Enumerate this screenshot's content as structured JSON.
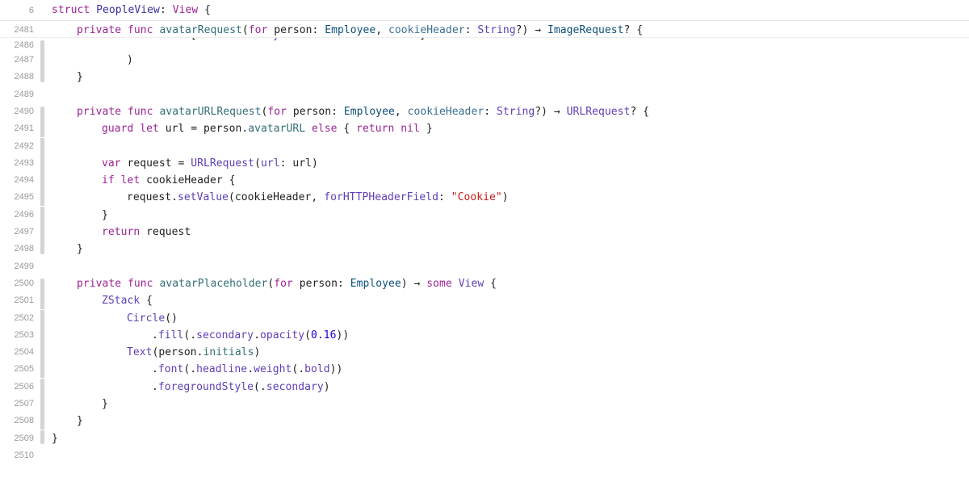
{
  "editor": {
    "sticky_header": {
      "line_number": "6",
      "tokens": [
        {
          "t": "struct",
          "c": "kw"
        },
        {
          "t": " "
        },
        {
          "t": "PeopleView",
          "c": "ty"
        },
        {
          "t": ": "
        },
        {
          "t": "View",
          "c": "kw"
        },
        {
          "t": " {"
        }
      ]
    },
    "partial_line": {
      "indent": 3,
      "tokens": [
        {
          "t": "userInfo: ["
        },
        {
          "t": ".thumbnailKey",
          "c": "mb"
        },
        {
          "t": ": "
        },
        {
          "t": "Self",
          "c": "kw"
        },
        {
          "t": "."
        },
        {
          "t": "avatarThumbnail",
          "c": "mb"
        },
        {
          "t": "]"
        }
      ]
    },
    "lines": [
      {
        "n": "2481",
        "indent": 1,
        "tokens": [
          {
            "t": "private",
            "c": "kw"
          },
          {
            "t": " "
          },
          {
            "t": "func",
            "c": "kw"
          },
          {
            "t": " "
          },
          {
            "t": "avatarRequest",
            "c": "fn"
          },
          {
            "t": "("
          },
          {
            "t": "for",
            "c": "kw"
          },
          {
            "t": " person: "
          },
          {
            "t": "Employee",
            "c": "typ"
          },
          {
            "t": ", "
          },
          {
            "t": "cookieHeader",
            "c": "lb"
          },
          {
            "t": ": "
          },
          {
            "t": "String",
            "c": "mb"
          },
          {
            "t": "?) → "
          },
          {
            "t": "ImageRequest",
            "c": "typ"
          },
          {
            "t": "? {"
          }
        ]
      },
      {
        "n": "2486",
        "indent": 0,
        "tokens": []
      },
      {
        "n": "2487",
        "indent": 3,
        "tokens": [
          {
            "t": ")"
          }
        ]
      },
      {
        "n": "2488",
        "indent": 1,
        "tokens": [
          {
            "t": "}"
          }
        ]
      },
      {
        "n": "2489",
        "indent": 0,
        "tokens": []
      },
      {
        "n": "2490",
        "indent": 1,
        "tokens": [
          {
            "t": "private",
            "c": "kw"
          },
          {
            "t": " "
          },
          {
            "t": "func",
            "c": "kw"
          },
          {
            "t": " "
          },
          {
            "t": "avatarURLRequest",
            "c": "fn"
          },
          {
            "t": "("
          },
          {
            "t": "for",
            "c": "kw"
          },
          {
            "t": " person: "
          },
          {
            "t": "Employee",
            "c": "typ"
          },
          {
            "t": ", "
          },
          {
            "t": "cookieHeader",
            "c": "lb"
          },
          {
            "t": ": "
          },
          {
            "t": "String",
            "c": "mb"
          },
          {
            "t": "?) → "
          },
          {
            "t": "URLRequest",
            "c": "mb"
          },
          {
            "t": "? {"
          }
        ]
      },
      {
        "n": "2491",
        "indent": 2,
        "tokens": [
          {
            "t": "guard",
            "c": "kw"
          },
          {
            "t": " "
          },
          {
            "t": "let",
            "c": "kw"
          },
          {
            "t": " url = person."
          },
          {
            "t": "avatarURL",
            "c": "fn"
          },
          {
            "t": " "
          },
          {
            "t": "else",
            "c": "kw"
          },
          {
            "t": " { "
          },
          {
            "t": "return",
            "c": "kw"
          },
          {
            "t": " "
          },
          {
            "t": "nil",
            "c": "kw"
          },
          {
            "t": " }"
          }
        ]
      },
      {
        "n": "2492",
        "indent": 0,
        "tokens": []
      },
      {
        "n": "2493",
        "indent": 2,
        "tokens": [
          {
            "t": "var",
            "c": "kw"
          },
          {
            "t": " request = "
          },
          {
            "t": "URLRequest",
            "c": "mb"
          },
          {
            "t": "("
          },
          {
            "t": "url",
            "c": "mb"
          },
          {
            "t": ": url)"
          }
        ]
      },
      {
        "n": "2494",
        "indent": 2,
        "tokens": [
          {
            "t": "if",
            "c": "kw"
          },
          {
            "t": " "
          },
          {
            "t": "let",
            "c": "kw"
          },
          {
            "t": " cookieHeader {"
          }
        ]
      },
      {
        "n": "2495",
        "indent": 3,
        "tokens": [
          {
            "t": "request."
          },
          {
            "t": "setValue",
            "c": "mb"
          },
          {
            "t": "(cookieHeader, "
          },
          {
            "t": "forHTTPHeaderField",
            "c": "mb"
          },
          {
            "t": ": "
          },
          {
            "t": "\"Cookie\"",
            "c": "str"
          },
          {
            "t": ")"
          }
        ]
      },
      {
        "n": "2496",
        "indent": 2,
        "tokens": [
          {
            "t": "}"
          }
        ]
      },
      {
        "n": "2497",
        "indent": 2,
        "tokens": [
          {
            "t": "return",
            "c": "kw"
          },
          {
            "t": " request"
          }
        ]
      },
      {
        "n": "2498",
        "indent": 1,
        "tokens": [
          {
            "t": "}"
          }
        ]
      },
      {
        "n": "2499",
        "indent": 0,
        "tokens": []
      },
      {
        "n": "2500",
        "indent": 1,
        "tokens": [
          {
            "t": "private",
            "c": "kw"
          },
          {
            "t": " "
          },
          {
            "t": "func",
            "c": "kw"
          },
          {
            "t": " "
          },
          {
            "t": "avatarPlaceholder",
            "c": "fn"
          },
          {
            "t": "("
          },
          {
            "t": "for",
            "c": "kw"
          },
          {
            "t": " person: "
          },
          {
            "t": "Employee",
            "c": "typ"
          },
          {
            "t": ") → "
          },
          {
            "t": "some",
            "c": "kw"
          },
          {
            "t": " "
          },
          {
            "t": "View",
            "c": "mb"
          },
          {
            "t": " {"
          }
        ]
      },
      {
        "n": "2501",
        "indent": 2,
        "tokens": [
          {
            "t": "ZStack",
            "c": "mb"
          },
          {
            "t": " {"
          }
        ]
      },
      {
        "n": "2502",
        "indent": 3,
        "tokens": [
          {
            "t": "Circle",
            "c": "mb"
          },
          {
            "t": "()"
          }
        ]
      },
      {
        "n": "2503",
        "indent": 4,
        "tokens": [
          {
            "t": "."
          },
          {
            "t": "fill",
            "c": "mb"
          },
          {
            "t": "(."
          },
          {
            "t": "secondary",
            "c": "mb"
          },
          {
            "t": "."
          },
          {
            "t": "opacity",
            "c": "mb"
          },
          {
            "t": "("
          },
          {
            "t": "0.16",
            "c": "num"
          },
          {
            "t": "))"
          }
        ]
      },
      {
        "n": "2504",
        "indent": 3,
        "tokens": [
          {
            "t": "Text",
            "c": "mb"
          },
          {
            "t": "(person."
          },
          {
            "t": "initials",
            "c": "fn"
          },
          {
            "t": ")"
          }
        ]
      },
      {
        "n": "2505",
        "indent": 4,
        "tokens": [
          {
            "t": "."
          },
          {
            "t": "font",
            "c": "mb"
          },
          {
            "t": "(."
          },
          {
            "t": "headline",
            "c": "mb"
          },
          {
            "t": "."
          },
          {
            "t": "weight",
            "c": "mb"
          },
          {
            "t": "(."
          },
          {
            "t": "bold",
            "c": "mb"
          },
          {
            "t": "))"
          }
        ]
      },
      {
        "n": "2506",
        "indent": 4,
        "tokens": [
          {
            "t": "."
          },
          {
            "t": "foregroundStyle",
            "c": "mb"
          },
          {
            "t": "(."
          },
          {
            "t": "secondary",
            "c": "mb"
          },
          {
            "t": ")"
          }
        ]
      },
      {
        "n": "2507",
        "indent": 2,
        "tokens": [
          {
            "t": "}"
          }
        ]
      },
      {
        "n": "2508",
        "indent": 1,
        "tokens": [
          {
            "t": "}"
          }
        ]
      },
      {
        "n": "2509",
        "indent": 0,
        "tokens": [
          {
            "t": "}"
          }
        ]
      },
      {
        "n": "2510",
        "indent": 0,
        "tokens": []
      }
    ],
    "change_markers": [
      "2486",
      "2487",
      "2488",
      "2490",
      "2491",
      "2492",
      "2493",
      "2494",
      "2495",
      "2496",
      "2497",
      "2498",
      "2500",
      "2501",
      "2502",
      "2503",
      "2504",
      "2505",
      "2506",
      "2507",
      "2508",
      "2509"
    ],
    "colors": {
      "keyword": "#9b2393",
      "type_declared": "#3a2ea0",
      "type_project": "#0b4f79",
      "function_project": "#326d74",
      "member_system": "#5f3db6",
      "label": "#3a6f93",
      "string": "#c41a16",
      "number": "#1c00cf",
      "plain": "#1f1f1f",
      "line_number": "#9a9a9a",
      "change_bar": "#d4d4d4"
    }
  }
}
